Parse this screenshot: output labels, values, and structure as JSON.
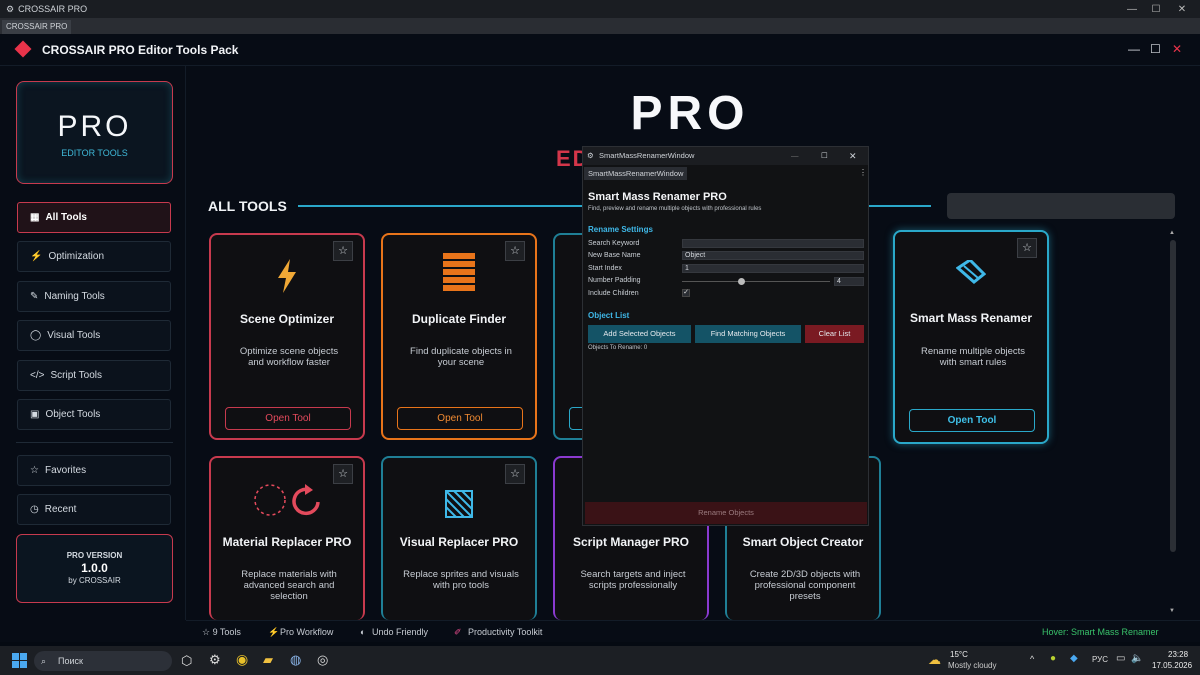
{
  "os": {
    "title": "CROSSAIR PRO",
    "tab": "CROSSAIR PRO"
  },
  "header": {
    "title": "CROSSAIR PRO Editor Tools Pack"
  },
  "brand": {
    "big": "PRO",
    "sub": "EDITOR TOOLS"
  },
  "nav": [
    {
      "icon": "▦",
      "label": "All Tools",
      "active": true
    },
    {
      "icon": "⚡",
      "label": "Optimization"
    },
    {
      "icon": "✎",
      "label": "Naming Tools"
    },
    {
      "icon": "◯",
      "label": "Visual Tools"
    },
    {
      "icon": "</>",
      "label": "Script Tools"
    },
    {
      "icon": "▣",
      "label": "Object Tools"
    },
    {
      "icon": "☆",
      "label": "Favorites"
    },
    {
      "icon": "◷",
      "label": "Recent"
    }
  ],
  "version": {
    "title": "PRO VERSION",
    "number": "1.0.0",
    "by": "by CROSSAIR"
  },
  "hero": {
    "title": "PRO",
    "sub": "ED"
  },
  "section": {
    "title": "ALL TOOLS"
  },
  "cards": [
    {
      "name": "Scene Optimizer",
      "desc": "Optimize scene objects and workflow faster",
      "button": "Open Tool",
      "icon": "bolt-icon"
    },
    {
      "name": "Duplicate Finder",
      "desc": "Find duplicate objects in your scene",
      "button": "Open Tool",
      "icon": "stack-icon"
    },
    {
      "name": "Smart Mass Renamer",
      "desc": "Rename multiple objects with smart rules",
      "button": "Open Tool",
      "icon": "pencil-icon"
    },
    {
      "name": "Material Replacer PRO",
      "desc": "Replace materials with advanced search and selection",
      "icon": "refresh-icon"
    },
    {
      "name": "Visual Replacer PRO",
      "desc": "Replace sprites and visuals with pro tools",
      "icon": "hatch-icon"
    },
    {
      "name": "Script Manager PRO",
      "desc": "Search targets and inject scripts professionally"
    },
    {
      "name": "Smart Object Creator",
      "desc": "Create 2D/3D objects with professional component presets"
    }
  ],
  "bottom": {
    "count": "☆ 9 Tools",
    "workflow": "Pro Workflow",
    "undo": "Undo Friendly",
    "toolkit": "Productivity Toolkit",
    "hover": "Hover: Smart Mass Renamer"
  },
  "window": {
    "title": "SmartMassRenamerWindow",
    "tab": "SmartMassRenamerWindow",
    "heading": "Smart Mass Renamer PRO",
    "subheading": "Find, preview and rename multiple objects with professional rules",
    "settings_title": "Rename Settings",
    "labels": {
      "keyword": "Search Keyword",
      "base": "New Base Name",
      "start": "Start Index",
      "padding": "Number Padding",
      "children": "Include Children"
    },
    "values": {
      "keyword": "",
      "base": "Object",
      "start": "1",
      "padding": "4"
    },
    "padding_level": 0.4,
    "list_title": "Object List",
    "buttons": {
      "add": "Add Selected Objects",
      "find": "Find Matching Objects",
      "clear": "Clear List"
    },
    "count": "Objects To Rename: 0",
    "rename": "Rename Objects"
  },
  "taskbar": {
    "search": "Поиск",
    "temp": "15°C",
    "weather": "Mostly cloudy",
    "lang": "РУС",
    "time": "23:28",
    "date": "17.05.2026"
  },
  "colors": {
    "red": "#c73a4e",
    "orange": "#e8741a",
    "cyan": "#2aa8c9",
    "purple": "#8a3ad0"
  }
}
